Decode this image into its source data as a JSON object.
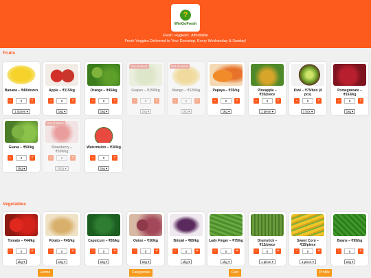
{
  "header": {
    "logo_text": "WinGoFresh",
    "tagline_1": "Fresh. Hygienic. Affordable",
    "tagline_2": "Fresh Veggies Delivered to Your Doorstep, Every Wednesday & Sunday!",
    "bg_color": "#fd5a1e"
  },
  "fruits": {
    "section_title": "Fruits",
    "items": [
      {
        "title": "Banana – ₹40/dozen",
        "qty": "0",
        "unit": "1 dozen",
        "oos": false,
        "img": "banana"
      },
      {
        "title": "Apple – ₹115/kg",
        "qty": "0",
        "unit": "1kg",
        "oos": false,
        "img": "apple"
      },
      {
        "title": "Orange – ₹45/kg",
        "qty": "0",
        "unit": "1kg",
        "oos": false,
        "img": "orange"
      },
      {
        "title": "Grapes – ₹150/kg",
        "qty": "0",
        "unit": "1kg",
        "oos": true,
        "oos_label": "Out of Stock",
        "img": "grapes"
      },
      {
        "title": "Mango – ₹120/kg",
        "qty": "0",
        "unit": "1kg",
        "oos": true,
        "oos_label": "Out of Stock",
        "img": "mango"
      },
      {
        "title": "Papaya – ₹35/kg",
        "qty": "0",
        "unit": "1kg",
        "oos": false,
        "img": "papaya"
      },
      {
        "title": "Pineapple – ₹35/piece",
        "qty": "0",
        "unit": "1 piece",
        "oos": false,
        "img": "pineapple"
      },
      {
        "title": "Kiwi – ₹75/box (4 pcs)",
        "qty": "0",
        "unit": "1 box",
        "oos": false,
        "img": "kiwi"
      },
      {
        "title": "Pomegranate – ₹163/kg",
        "qty": "0",
        "unit": "1kg",
        "oos": false,
        "img": "pomegranate"
      },
      {
        "title": "Guava – ₹59/kg",
        "qty": "0",
        "unit": "1kg",
        "oos": false,
        "img": "guava"
      },
      {
        "title": "Strawberry – ₹300/kg",
        "qty": "0",
        "unit": "250g",
        "oos": true,
        "oos_label": "Out of Stock",
        "img": "strawberry"
      },
      {
        "title": "Watermelon – ₹30/kg",
        "qty": "0",
        "unit": "1kg",
        "oos": false,
        "img": "watermelon"
      }
    ]
  },
  "vegetables": {
    "section_title": "Vegetables",
    "items": [
      {
        "title": "Tomato – ₹44/kg",
        "qty": "0",
        "unit": "1kg",
        "img": "tomato"
      },
      {
        "title": "Potato – ₹45/kg",
        "qty": "0",
        "unit": "1kg",
        "img": "potato"
      },
      {
        "title": "Capsicum – ₹85/kg",
        "qty": "0",
        "unit": "1kg",
        "img": "capsicum"
      },
      {
        "title": "Onion – ₹30/kg",
        "qty": "0",
        "unit": "1kg",
        "img": "onion"
      },
      {
        "title": "Brinjal – ₹65/kg",
        "qty": "0",
        "unit": "1kg",
        "img": "brinjal"
      },
      {
        "title": "Lady Finger – ₹75/kg",
        "qty": "0",
        "unit": "1kg",
        "img": "ladyfinger"
      },
      {
        "title": "Drumstick – ₹12/piece",
        "qty": "0",
        "unit": "1 piece",
        "img": "drumstick"
      },
      {
        "title": "Sweet Corn – ₹15/piece",
        "qty": "0",
        "unit": "1 piece",
        "img": "corn"
      },
      {
        "title": "Beans – ₹95/kg",
        "qty": "0",
        "unit": "1kg",
        "img": "beans"
      }
    ]
  },
  "controls": {
    "minus": "-",
    "plus": "+"
  },
  "nav": {
    "home": "Home",
    "categories": "Categories",
    "cart": "Cart",
    "profile": "Profile"
  }
}
